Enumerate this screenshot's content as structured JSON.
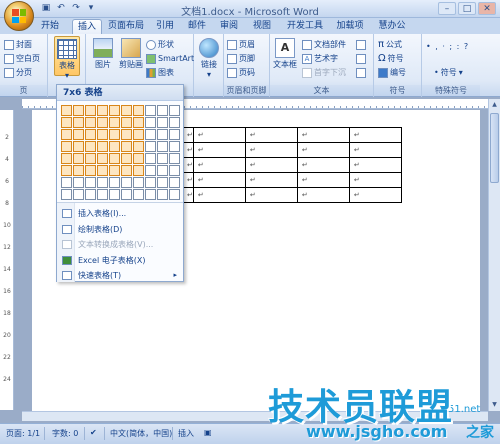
{
  "window": {
    "title": "文档1.docx - Microsoft Word",
    "minimize": "–",
    "maximize": "□",
    "close": "✕"
  },
  "tabs": [
    "开始",
    "插入",
    "页面布局",
    "引用",
    "邮件",
    "审阅",
    "视图",
    "开发工具",
    "加载项",
    "慧办公"
  ],
  "active_tab": "插入",
  "ribbon": {
    "pages": {
      "label": "页",
      "items": [
        "封面",
        "空白页",
        "分页"
      ]
    },
    "table_btn": "表格",
    "illustrations": {
      "picture": "图片",
      "clipart": "剪贴画",
      "shape": "形状",
      "smartart": "SmartArt",
      "chart": "图表"
    },
    "link": "链接",
    "header_footer": {
      "label": "页眉和页脚",
      "header": "页眉",
      "footer": "页脚",
      "page_no": "页码"
    },
    "text": {
      "label": "文本",
      "textbox": "文本框",
      "parts": "文档部件",
      "wordart": "艺术字",
      "dropcap": "首字下沉",
      "sig": "签名行",
      "date": "日期和时间",
      "object": "对象"
    },
    "symbols": {
      "label": "符号",
      "formula": "公式",
      "symbol": "符号",
      "number": "编号"
    },
    "special": {
      "label": "特殊符号",
      "dots": "•  ,  ·  ;  :  ?",
      "symbol": "符号"
    }
  },
  "dropdown": {
    "header": "7x6 表格",
    "grid": {
      "cols": 10,
      "rows": 8,
      "sel_cols": 7,
      "sel_rows": 6
    },
    "items": [
      {
        "label": "插入表格(I)...",
        "disabled": false,
        "submenu": false
      },
      {
        "label": "绘制表格(D)",
        "disabled": false,
        "submenu": false
      },
      {
        "label": "文本转换成表格(V)...",
        "disabled": true,
        "submenu": false
      },
      {
        "label": "Excel 电子表格(X)",
        "disabled": false,
        "submenu": false
      },
      {
        "label": "快速表格(T)",
        "disabled": false,
        "submenu": true
      }
    ]
  },
  "doc": {
    "cell_mark": "↵",
    "rows": 5,
    "cols": 5
  },
  "ruler_numbers": [
    "2",
    "4",
    "6",
    "8",
    "10",
    "12",
    "14",
    "16",
    "18",
    "20",
    "22",
    "24"
  ],
  "status": {
    "page": "页面: 1/1",
    "words": "字数: 0",
    "lang": "中文(简体，中国)",
    "mode": "插入"
  },
  "watermark": {
    "main": "技术员联盟",
    "sub": "www.jsgho.com",
    "corner": "51.net",
    "home": "之家"
  },
  "colors": {
    "accent": "#15428b",
    "selection": "#fde6c2",
    "watermark": "#1e9bd8"
  }
}
